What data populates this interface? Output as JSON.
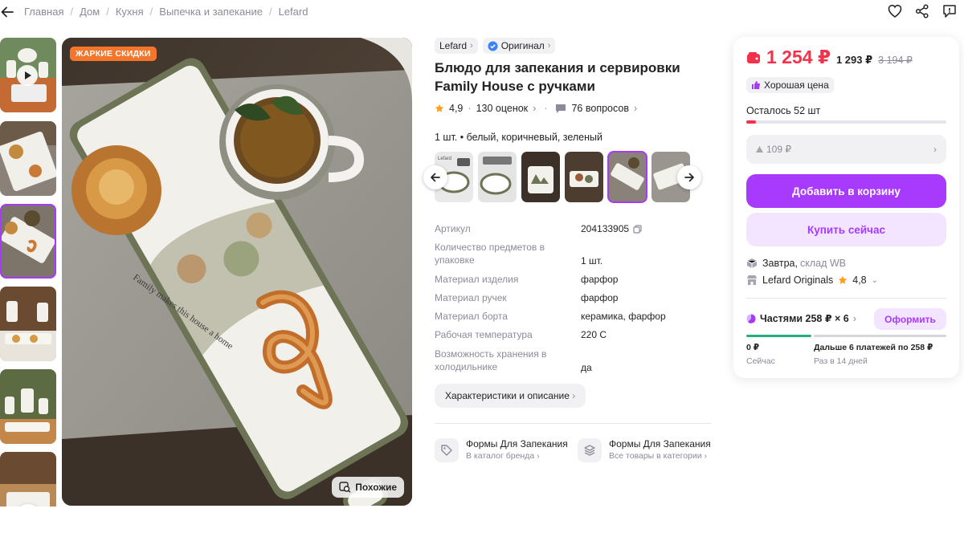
{
  "breadcrumbs": [
    "Главная",
    "Дом",
    "Кухня",
    "Выпечка и запекание",
    "Lefard"
  ],
  "gallery": {
    "promo_badge": "ЖАРКИЕ СКИДКИ",
    "similar_label": "Похожие",
    "plate_text": "Family makes this house a home"
  },
  "product": {
    "brand": "Lefard",
    "original_label": "Оригинал",
    "title": "Блюдо для запекания и сервировки Family House с ручками",
    "rating": "4,9",
    "reviews": "130 оценок",
    "questions": "76 вопросов",
    "variant": "1 шт. • белый, коричневый, зеленый",
    "swatch_brand": "Lefard"
  },
  "specs": [
    {
      "key": "Артикул",
      "value": "204133905"
    },
    {
      "key": "Количество предметов в упаковке",
      "value": "1 шт."
    },
    {
      "key": "Материал изделия",
      "value": "фарфор"
    },
    {
      "key": "Материал ручек",
      "value": "фарфор"
    },
    {
      "key": "Материал борта",
      "value": "керамика, фарфор"
    },
    {
      "key": "Рабочая температура",
      "value": "220 С"
    },
    {
      "key": "Возможность хранения в холодильнике",
      "value": "да"
    }
  ],
  "all_chars_label": "Характеристики и описание",
  "links": [
    {
      "title": "Формы Для Запекания",
      "sub": "В каталог бренда"
    },
    {
      "title": "Формы Для Запекания",
      "sub": "Все товары в категории"
    }
  ],
  "buy": {
    "price": "1 254 ₽",
    "price2": "1 293 ₽",
    "old_price": "3 194 ₽",
    "good_price": "Хорошая цена",
    "stock": "Осталось 52 шт",
    "stock_fraction": 0.05,
    "bonus": "109 ₽",
    "add_to_cart": "Добавить в корзину",
    "buy_now": "Купить сейчас",
    "delivery": "Завтра,",
    "warehouse": "склад WB",
    "seller": "Lefard Originals",
    "seller_rating": "4,8",
    "installments": "Частями 258 ₽ × 6",
    "checkout": "Оформить",
    "pay_now": "0 ₽",
    "pay_now_sub": "Сейчас",
    "pay_later": "Дальше 6 платежей по 258 ₽",
    "pay_later_sub": "Раз в 14 дней"
  },
  "colors": {
    "accent": "#a73afd",
    "price": "#f2324a",
    "promo": "#f5762b",
    "progress": "#22b07d"
  }
}
